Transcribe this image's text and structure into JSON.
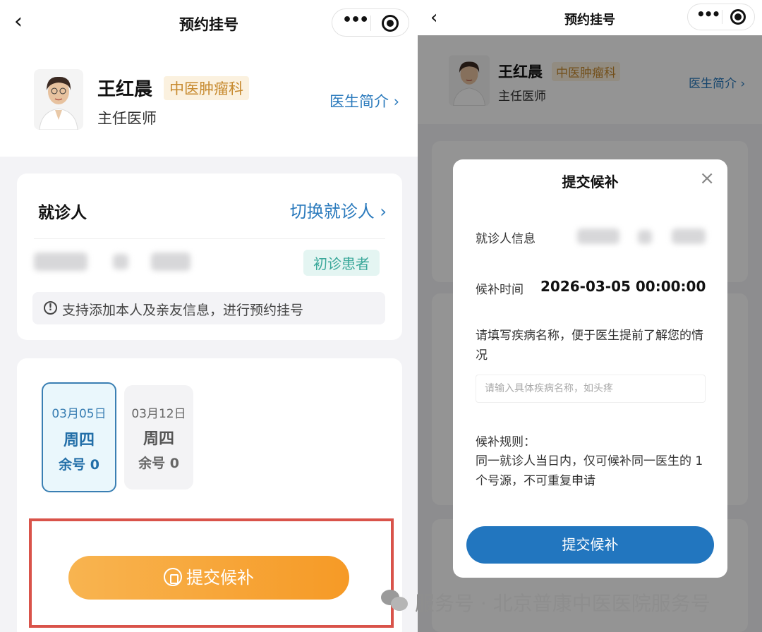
{
  "left": {
    "nav": {
      "back": "‹",
      "title": "预约挂号"
    },
    "doctor": {
      "name": "王红晨",
      "department": "中医肿瘤科",
      "title": "主任医师",
      "intro_link": "医生简介 ›"
    },
    "patient": {
      "label": "就诊人",
      "switch_link": "切换就诊人 ›",
      "badge": "初诊患者",
      "notice_icon": "!",
      "notice": "支持添加本人及亲友信息，进行预约挂号"
    },
    "dates": [
      {
        "date": "03月05日",
        "weekday": "周四",
        "remaining": "余号 0",
        "selected": true
      },
      {
        "date": "03月12日",
        "weekday": "周四",
        "remaining": "余号 0",
        "selected": false
      }
    ],
    "submit_label": "提交候补",
    "highlight_color": "#d9534a"
  },
  "right": {
    "nav": {
      "back": "‹",
      "title": "预约挂号"
    },
    "doctor": {
      "name": "王红晨",
      "department": "中医肿瘤科",
      "title": "主任医师",
      "intro_link": "医生简介 ›"
    },
    "modal": {
      "title": "提交候补",
      "close": "×",
      "patient_info_label": "就诊人信息",
      "waitlist_time_label": "候补时间",
      "waitlist_time": "2026-03-05 00:00:00",
      "disease_hint": "请填写疾病名称，便于医生提前了解您的情况",
      "disease_placeholder": "请输入具体疾病名称，如头疼",
      "rules_title": "候补规则：",
      "rules_text": "同一就诊人当日内，仅可候补同一医生的 1 个号源，不可重复申请",
      "submit_label": "提交候补"
    }
  },
  "watermark": {
    "text": "服务号 · 北京普康中医医院服务号"
  },
  "colors": {
    "accent_blue": "#2276bf",
    "link_blue": "#2c7bbd",
    "orange": "#f69a26",
    "teal": "#3aa89a"
  },
  "icons": [
    "back-icon",
    "more-icon",
    "close-mini-program-icon",
    "chevron-right-icon",
    "info-icon",
    "waitlist-icon",
    "close-icon",
    "wechat-icon"
  ]
}
